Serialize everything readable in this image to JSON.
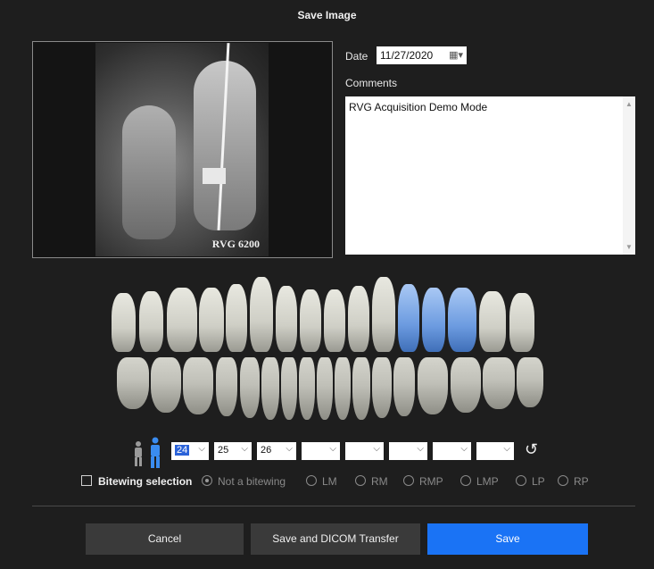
{
  "dialog": {
    "title": "Save Image"
  },
  "preview": {
    "watermark": "RVG 6200"
  },
  "date": {
    "label": "Date",
    "value": "11/27/2020"
  },
  "comments": {
    "label": "Comments",
    "value": "RVG Acquisition Demo Mode"
  },
  "tooth_selectors": {
    "values": [
      "24",
      "25",
      "26",
      "",
      "",
      "",
      "",
      ""
    ],
    "active_index": 0
  },
  "bitewing": {
    "checkbox_label": "Bitewing selection",
    "options": [
      "Not a bitewing",
      "LM",
      "RM",
      "RMP",
      "LMP",
      "LP",
      "RP"
    ],
    "selected": "Not a bitewing"
  },
  "buttons": {
    "cancel": "Cancel",
    "dicom": "Save and DICOM Transfer",
    "save": "Save"
  },
  "colors": {
    "accent": "#1a73f5",
    "selected_tooth": "#6c9be0",
    "background": "#1e1e1e"
  }
}
